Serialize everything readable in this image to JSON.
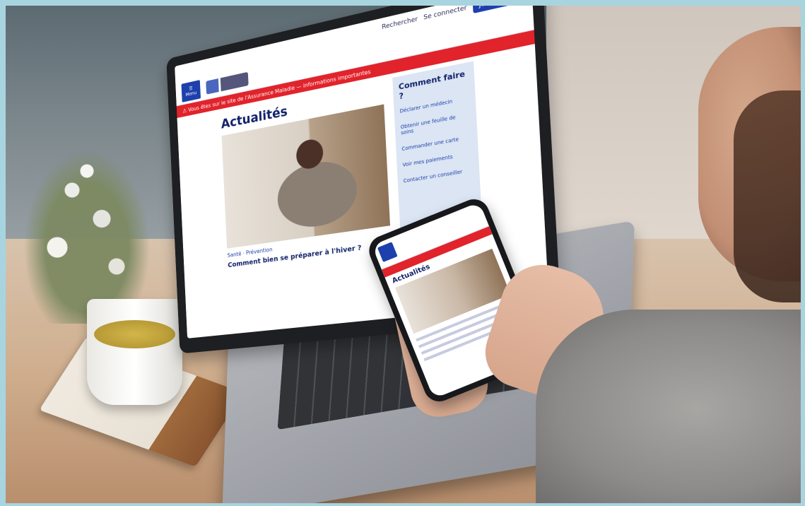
{
  "laptop": {
    "topbar": {
      "links": [
        "Rechercher",
        "Se connecter"
      ],
      "cta": "Je m'inscris"
    },
    "header": {
      "menu_label": "Menu"
    },
    "alert_text": "Vous êtes sur le site de l'Assurance Maladie — informations importantes",
    "page_title": "Actualités",
    "hero_caption": "Santé · Prévention",
    "hero_headline": "Comment bien se préparer à l'hiver ?",
    "sidebar": {
      "title": "Comment faire ?",
      "items": [
        "Déclarer un médecin",
        "Obtenir une feuille de soins",
        "Commander une carte",
        "Voir mes paiements",
        "Contacter un conseiller"
      ]
    }
  },
  "phone": {
    "title": "Actualités"
  },
  "colors": {
    "brand_blue": "#1e40ad",
    "navy": "#13236b",
    "alert_red": "#e1232b",
    "frame_bg": "#a8d4e0"
  }
}
